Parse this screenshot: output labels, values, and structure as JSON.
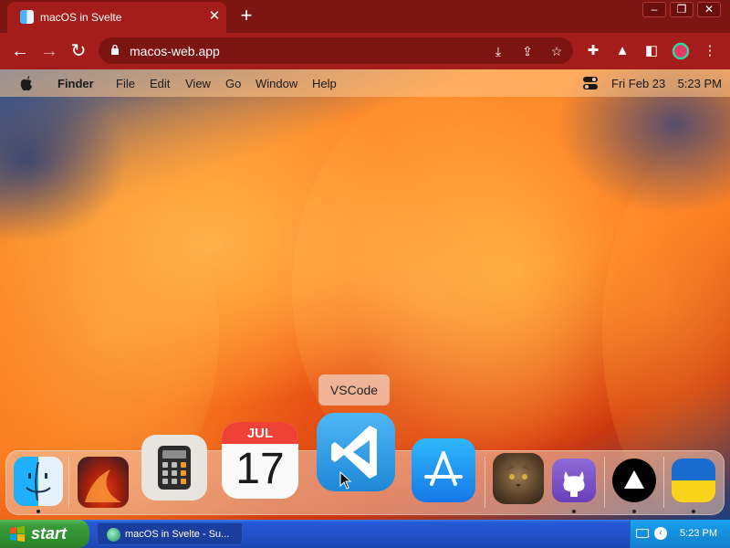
{
  "browser": {
    "tab_title": "macOS in Svelte",
    "url": "macos-web.app",
    "new_tab_symbol": "+",
    "close_symbol": "✕"
  },
  "menubar": {
    "app_name": "Finder",
    "menus": [
      "File",
      "Edit",
      "View",
      "Go",
      "Window",
      "Help"
    ],
    "date": "Fri Feb 23",
    "time": "5:23 PM"
  },
  "dock": {
    "tooltip": "VSCode",
    "calendar_month": "JUL",
    "calendar_day": "17",
    "items": [
      {
        "name": "Finder",
        "icon": "finder-icon",
        "running": true
      },
      {
        "name": "Wallpapers",
        "icon": "wallpaper-icon",
        "running": false
      },
      {
        "name": "Calculator",
        "icon": "calculator-icon",
        "running": false
      },
      {
        "name": "Calendar",
        "icon": "calendar-icon",
        "running": false
      },
      {
        "name": "VSCode",
        "icon": "vscode-icon",
        "running": false
      },
      {
        "name": "App Store",
        "icon": "app-store-icon",
        "running": false
      },
      {
        "name": "Cat photo",
        "icon": "cat-icon",
        "running": false
      },
      {
        "name": "GitHub",
        "icon": "github-icon",
        "running": true
      },
      {
        "name": "Vercel",
        "icon": "vercel-icon",
        "running": true
      },
      {
        "name": "Ukraine",
        "icon": "ukraine-flag-icon",
        "running": true
      }
    ]
  },
  "taskbar": {
    "start_label": "start",
    "task_label": "macOS in Svelte - Su...",
    "time": "5:23 PM"
  },
  "colors": {
    "chrome_dark": "#7d1512",
    "chrome_mid": "#a51d1a",
    "xp_blue": "#2350c7",
    "xp_green": "#3a9c3a"
  }
}
